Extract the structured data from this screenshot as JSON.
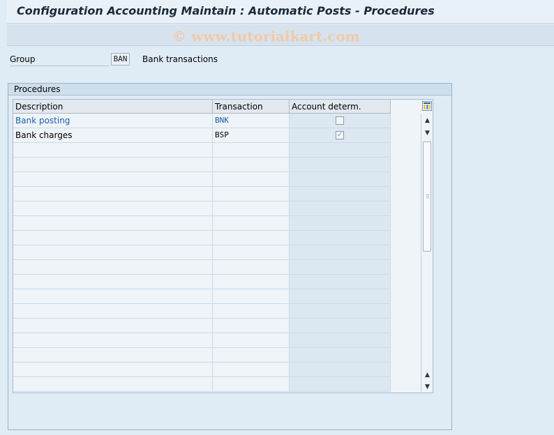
{
  "window": {
    "title": "Configuration Accounting Maintain : Automatic Posts - Procedures"
  },
  "watermark": "© www.tutorialkart.com",
  "group": {
    "label": "Group",
    "value": "BAN",
    "description": "Bank transactions"
  },
  "procedures": {
    "title": "Procedures",
    "columns": [
      "Description",
      "Transaction",
      "Account determ."
    ],
    "rows": [
      {
        "description": "Bank posting",
        "transaction": "BNK",
        "account_determ": false
      },
      {
        "description": "Bank charges",
        "transaction": "BSP",
        "account_determ": true
      }
    ],
    "empty_rows": 17
  },
  "icons": {
    "table_settings": "table-settings-icon",
    "scroll_up": "scroll-up-arrow-icon",
    "scroll_down": "scroll-down-arrow-icon",
    "checkmark": "checkmark-icon"
  }
}
